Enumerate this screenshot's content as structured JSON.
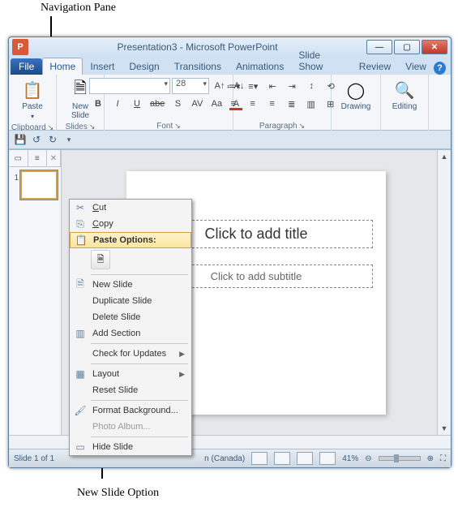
{
  "annotations": {
    "navpane": "Navigation Pane",
    "newslide": "New Slide Option"
  },
  "window": {
    "title": "Presentation3 - Microsoft PowerPoint",
    "app_badge": "P"
  },
  "tabs": {
    "file": "File",
    "items": [
      "Home",
      "Insert",
      "Design",
      "Transitions",
      "Animations",
      "Slide Show",
      "Review",
      "View"
    ]
  },
  "ribbon": {
    "clipboard": {
      "label": "Clipboard",
      "paste": "Paste"
    },
    "slides": {
      "label": "Slides",
      "newslide": "New\nSlide"
    },
    "font": {
      "label": "Font",
      "family_placeholder": "",
      "size_placeholder": "28"
    },
    "paragraph": {
      "label": "Paragraph"
    },
    "drawing": {
      "label": "Drawing"
    },
    "editing": {
      "label": "Editing"
    }
  },
  "navpane": {
    "slide_number": "1"
  },
  "canvas": {
    "title_placeholder": "Click to add title",
    "subtitle_placeholder": "Click to add subtitle"
  },
  "context_menu": {
    "cut": "Cut",
    "copy": "Copy",
    "paste_options": "Paste Options:",
    "new_slide": "New Slide",
    "duplicate_slide": "Duplicate Slide",
    "delete_slide": "Delete Slide",
    "add_section": "Add Section",
    "check_updates": "Check for Updates",
    "layout": "Layout",
    "reset_slide": "Reset Slide",
    "format_bg": "Format Background...",
    "photo_album": "Photo Album...",
    "hide_slide": "Hide Slide"
  },
  "statusbar": {
    "slide": "Slide 1 of 1",
    "lang": "n (Canada)",
    "zoom": "41%"
  },
  "chart_data": null
}
